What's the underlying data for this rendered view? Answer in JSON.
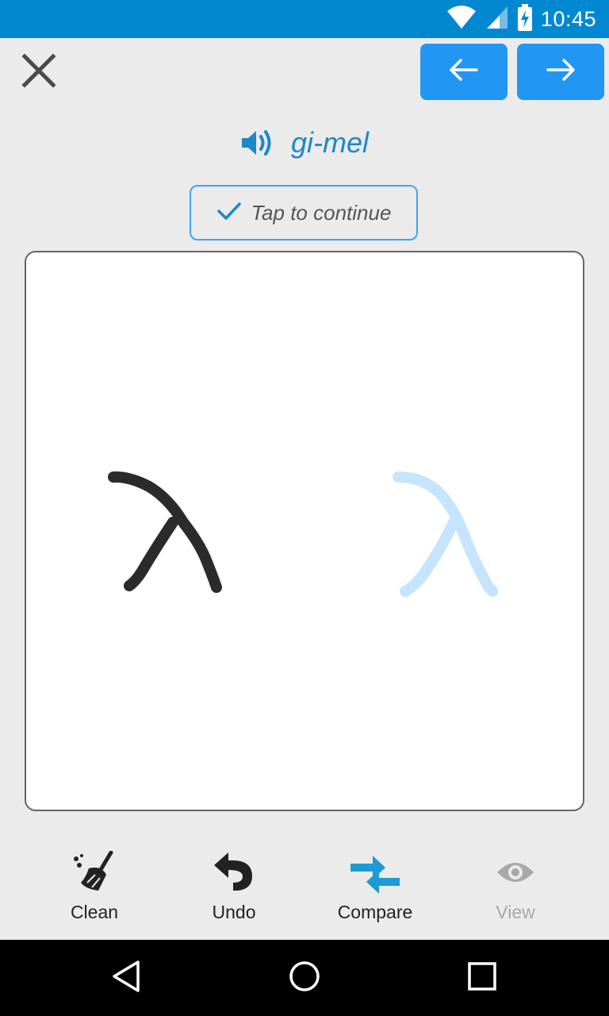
{
  "status_bar": {
    "time": "10:45",
    "icons": [
      "wifi-icon",
      "signal-icon",
      "battery-charging-icon"
    ]
  },
  "header": {
    "close_icon": "close-icon",
    "prev_icon": "arrow-left-icon",
    "next_icon": "arrow-right-icon"
  },
  "word": {
    "text": "gi-mel",
    "speaker_icon": "speaker-icon",
    "accent_color": "#1e88c8"
  },
  "continue": {
    "label": "Tap to continue",
    "icon": "check-icon"
  },
  "canvas": {
    "user_stroke_color": "#2b2b2b",
    "reference_stroke_color": "#bfe3fb",
    "reference_glyph": "λ"
  },
  "toolbar": {
    "items": [
      {
        "label": "Clean",
        "icon": "broom-icon",
        "enabled": true
      },
      {
        "label": "Undo",
        "icon": "undo-icon",
        "enabled": true
      },
      {
        "label": "Compare",
        "icon": "compare-arrows-icon",
        "enabled": true
      },
      {
        "label": "View",
        "icon": "eye-icon",
        "enabled": false
      }
    ]
  },
  "system_nav": {
    "icons": [
      "back-icon",
      "home-icon",
      "recents-icon"
    ]
  },
  "colors": {
    "primary": "#2196f3",
    "status_bar": "#0288d1",
    "background": "#ebebeb"
  }
}
